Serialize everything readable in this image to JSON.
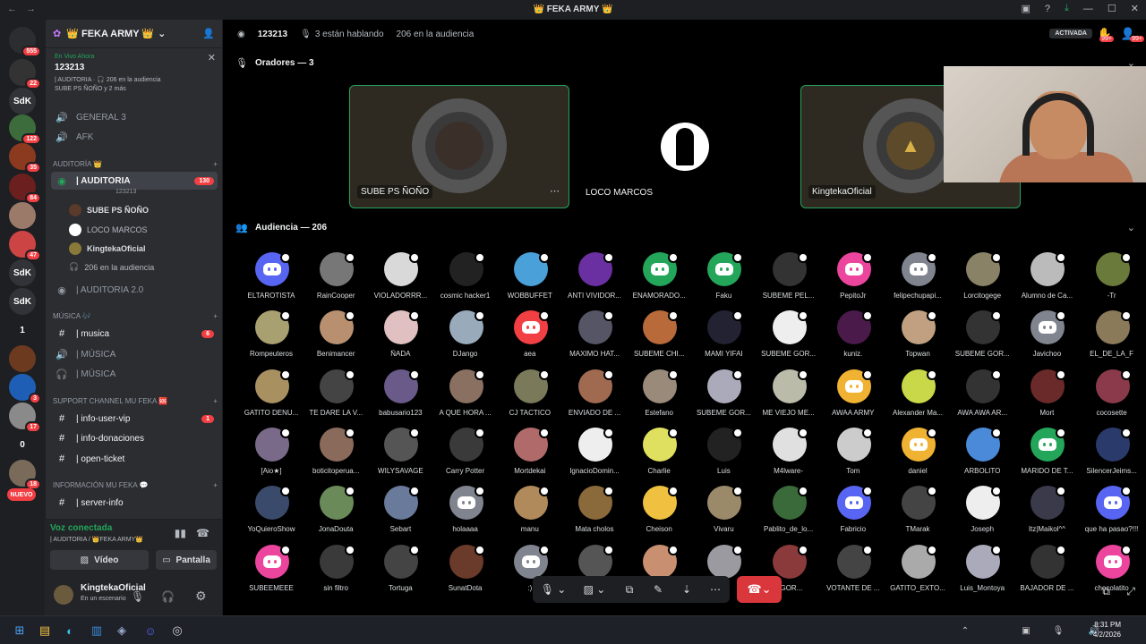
{
  "window": {
    "title": "👑 FEKA ARMY 👑"
  },
  "guilds": [
    {
      "label": "",
      "badge": "555",
      "color": "#2b2d31"
    },
    {
      "label": "",
      "badge": "22",
      "color": "#333"
    },
    {
      "label": "SdK",
      "badge": "",
      "color": "#313338"
    },
    {
      "label": "",
      "badge": "122",
      "color": "#3c6b3c"
    },
    {
      "label": "",
      "badge": "35",
      "color": "#8b3a1f"
    },
    {
      "label": "",
      "badge": "84",
      "color": "#6b1f1f"
    },
    {
      "label": "",
      "badge": "",
      "color": "#9b7a6a"
    },
    {
      "label": "",
      "badge": "47",
      "color": "#c44"
    },
    {
      "label": "SdK",
      "badge": "",
      "color": "#313338"
    },
    {
      "label": "SdK",
      "badge": "",
      "color": "#313338"
    },
    {
      "label": "1",
      "badge": "",
      "color": "#1e1f22"
    },
    {
      "label": "",
      "badge": "",
      "color": "#6b3a1f"
    },
    {
      "label": "",
      "badge": "3",
      "color": "#1e5fb5"
    },
    {
      "label": "",
      "badge": "17",
      "color": "#8a8a8a"
    },
    {
      "label": "0",
      "badge": "",
      "color": "#1e1f22"
    },
    {
      "label": "",
      "badge": "18",
      "color": "#7a6a5a"
    },
    {
      "label": "NUEVO",
      "badge": "",
      "color": "#f23f43"
    }
  ],
  "server": {
    "name": "👑 FEKA ARMY 👑"
  },
  "live": {
    "label": "En Vivo Ahora",
    "title": "123213",
    "subtitle": "| AUDITORIA · 🎧 206 en la audiencia",
    "speakers": "SUBE PS ÑOÑO y 2 más"
  },
  "channels": {
    "general": "GENERAL 3",
    "afk": "AFK",
    "cat_auditoria": "AUDITORÍA 👑",
    "auditoria": "| AUDITORIA",
    "auditoria_badge": "130",
    "auditoria_sub": "123213",
    "speakers": [
      "SUBE PS ÑOÑO",
      "LOCO MARCOS",
      "KingtekaOficial"
    ],
    "audience": "206 en la audiencia",
    "auditoria2": "| AUDITORIA 2.0",
    "cat_musica": "MÚSICA 🎶",
    "musica": "| musica",
    "musica_badge": "6",
    "musica2": "| MÚSICA",
    "musica3": "| MÚSICA",
    "cat_support": "SUPPORT CHANNEL MU FEKA 🆘",
    "info_vip": "| info-user-vip",
    "info_vip_badge": "1",
    "info_don": "| info-donaciones",
    "open_ticket": "| open-ticket",
    "cat_info": "INFORMACIÓN MU FEKA 💬",
    "server_info": "| server-info"
  },
  "voice": {
    "status": "Voz conectada",
    "location": "| AUDITORIA / 👑FEKA ARMY👑",
    "video": "Vídeo",
    "screen": "Pantalla"
  },
  "user": {
    "name": "KingtekaOficial",
    "status": "En un escenario"
  },
  "stage": {
    "name": "123213",
    "talking": "3 están hablando",
    "audience": "206 en la audiencia",
    "activated": "ACTIVADA",
    "hand_badge": "99+",
    "other_badge": "99+"
  },
  "speakers_header": "Oradores — 3",
  "speakers": [
    {
      "name": "SUBE PS ÑOÑO",
      "color": "#3b2f2a"
    },
    {
      "name": "LOCO MARCOS",
      "color": "#000"
    },
    {
      "name": "KingtekaOficial",
      "color": "#5c4a2a"
    }
  ],
  "audience_header": "Audiencia — 206",
  "audience": [
    [
      "ELTAROTISTA",
      "#5865f2",
      true
    ],
    [
      "RainCooper",
      "#777",
      false
    ],
    [
      "VIOLADORRR...",
      "#d9d9d9",
      false
    ],
    [
      "cosmic hacker1",
      "#222",
      false
    ],
    [
      "WOBBUFFET",
      "#4aa0d8",
      false
    ],
    [
      "ANTI VIVIDOR...",
      "#6a2fa0",
      false
    ],
    [
      "ENAMORADO...",
      "#23a55a",
      true
    ],
    [
      "Faku",
      "#23a55a",
      true
    ],
    [
      "SUBEME PEL...",
      "#333",
      false
    ],
    [
      "PepitoJr",
      "#eb459e",
      true
    ],
    [
      "felipechupapi...",
      "#80848e",
      true
    ],
    [
      "Lorcitogege",
      "#8a8266",
      false
    ],
    [
      "Alumno de Ca...",
      "#bbb",
      false
    ],
    [
      "-Tr",
      "#6a7a3a",
      false
    ],
    [
      "Rompeuteros",
      "#a8a070",
      false
    ],
    [
      "Benimancer",
      "#b89070",
      false
    ],
    [
      "ÑADA",
      "#e0c0c0",
      false
    ],
    [
      "DJango",
      "#9ab",
      false
    ],
    [
      "aea",
      "#f23f43",
      true
    ],
    [
      "MAXIMO HAT...",
      "#556",
      false
    ],
    [
      "SUBEME CHI...",
      "#b86a3a",
      false
    ],
    [
      "MAMI YIFAI",
      "#223",
      false
    ],
    [
      "SUBEME GOR...",
      "#eee",
      false
    ],
    [
      "kuniz.",
      "#4a1a4a",
      false
    ],
    [
      "Topwan",
      "#c0a080",
      false
    ],
    [
      "SUBEME GOR...",
      "#333",
      false
    ],
    [
      "Javichoo",
      "#80848e",
      true
    ],
    [
      "EL_DE_LA_F",
      "#8a7a5a",
      false
    ],
    [
      "GATITO DENU...",
      "#a89060",
      false
    ],
    [
      "TE DARE LA V...",
      "#444",
      false
    ],
    [
      "babusario123",
      "#6a5a8a",
      false
    ],
    [
      "A QUE HORA ...",
      "#8a7060",
      false
    ],
    [
      "CJ TACTICO",
      "#7a7a5a",
      false
    ],
    [
      "ENVIADO DE ...",
      "#a06a50",
      false
    ],
    [
      "Estefano",
      "#9a8a7a",
      false
    ],
    [
      "SUBEME GOR...",
      "#aab",
      false
    ],
    [
      "ME VIEJO ME...",
      "#bba",
      false
    ],
    [
      "AWAA ARMY",
      "#f0b232",
      true
    ],
    [
      "Alexander Ma...",
      "#c8d848",
      false
    ],
    [
      "AWA AWA AR...",
      "#333",
      false
    ],
    [
      "Mort",
      "#6a2a2a",
      false
    ],
    [
      "cocosette",
      "#8a3a4a",
      false
    ],
    [
      "[Aio★]",
      "#7a6a8a",
      false
    ],
    [
      "boticitoperua...",
      "#8a6a5a",
      false
    ],
    [
      "WILYSAVAGE",
      "#555",
      false
    ],
    [
      "Carry Potter",
      "#3a3a3a",
      false
    ],
    [
      "Mortdekai",
      "#b06a6a",
      false
    ],
    [
      "IgnacioDomin...",
      "#eee",
      false
    ],
    [
      "Charlie",
      "#e0e060",
      false
    ],
    [
      "Luis",
      "#222",
      false
    ],
    [
      "M4lware-",
      "#e0e0e0",
      false
    ],
    [
      "Tom",
      "#ccc",
      false
    ],
    [
      "daniel",
      "#f0b232",
      true
    ],
    [
      "ARBOLITO",
      "#4a8ad8",
      false
    ],
    [
      "MARIDO DE T...",
      "#23a55a",
      true
    ],
    [
      "SilencerJeims...",
      "#2a3a6a",
      false
    ],
    [
      "YoQuieroShow",
      "#3a4a6a",
      false
    ],
    [
      "JonaDouta",
      "#6a8a5a",
      false
    ],
    [
      "Sebart",
      "#6a7a9a",
      false
    ],
    [
      "holaaaa",
      "#80848e",
      true
    ],
    [
      "manu",
      "#b08a5a",
      false
    ],
    [
      "Mata cholos",
      "#8a6a3a",
      false
    ],
    [
      "Cheison",
      "#f0c040",
      false
    ],
    [
      "Vivaru",
      "#9a8a6a",
      false
    ],
    [
      "Pablito_de_lo...",
      "#3a6a3a",
      false
    ],
    [
      "Fabricio",
      "#5865f2",
      true
    ],
    [
      "TMarak",
      "#444",
      false
    ],
    [
      "Joseph",
      "#eee",
      false
    ],
    [
      "Itz|Maikol^^",
      "#3a3a4a",
      false
    ],
    [
      "que ha pasao?!!!",
      "#5865f2",
      true
    ],
    [
      "SUBEEMEEE",
      "#eb459e",
      true
    ],
    [
      "sin filtro",
      "#3a3a3a",
      false
    ],
    [
      "Tortuga",
      "#444",
      false
    ],
    [
      "SunatDota",
      "#6a3a2a",
      false
    ],
    [
      ":)",
      "#80848e",
      true
    ],
    [
      "",
      "#555",
      false
    ],
    [
      "",
      "#c89070",
      false
    ],
    [
      "",
      "#9a9aa0",
      false
    ],
    [
      "...GOR...",
      "#8a3a3a",
      false
    ],
    [
      "VOTANTE DE ...",
      "#444",
      false
    ],
    [
      "GATITO_EXTO...",
      "#aaa",
      false
    ],
    [
      "Luis_Montoya",
      "#aab",
      false
    ],
    [
      "BAJADOR DE ...",
      "#333",
      false
    ],
    [
      "chocolatito",
      "#eb459e",
      true
    ]
  ],
  "taskbar": {
    "time": "8:31 PM",
    "date": "4/2/2026"
  }
}
